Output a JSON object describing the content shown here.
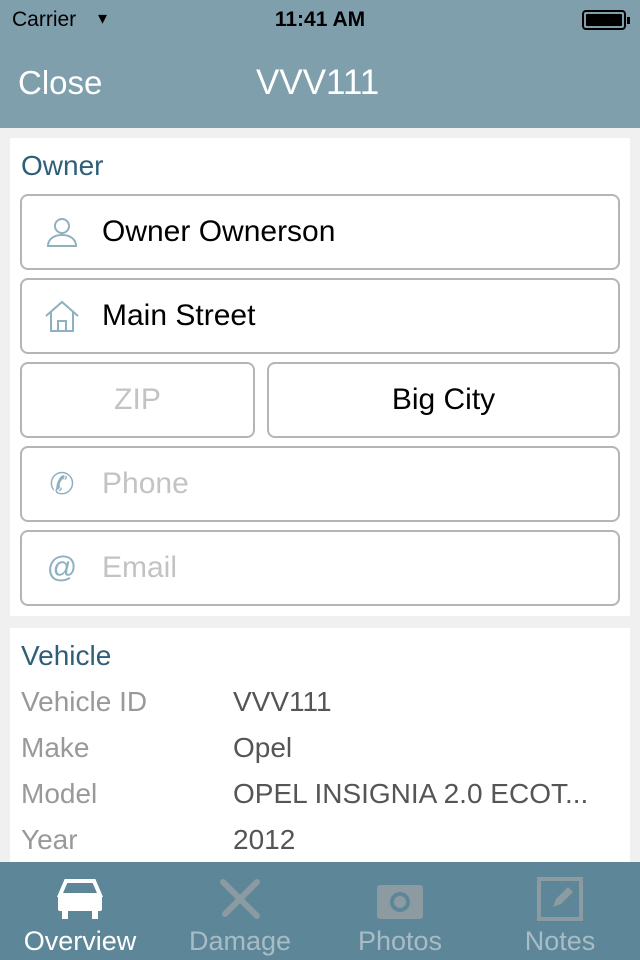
{
  "status_bar": {
    "carrier": "Carrier",
    "time": "11:41 AM"
  },
  "nav": {
    "close_label": "Close",
    "title": "VVV111"
  },
  "owner": {
    "section_title": "Owner",
    "name": "Owner Ownerson",
    "street": "Main Street",
    "zip_placeholder": "ZIP",
    "city": "Big City",
    "phone_placeholder": "Phone",
    "email_placeholder": "Email"
  },
  "vehicle": {
    "section_title": "Vehicle",
    "rows": [
      {
        "label": "Vehicle ID",
        "value": "VVV111"
      },
      {
        "label": "Make",
        "value": "Opel"
      },
      {
        "label": "Model",
        "value": "OPEL INSIGNIA 2.0 ECOT..."
      },
      {
        "label": "Year",
        "value": "2012"
      }
    ]
  },
  "tabs": [
    {
      "label": "Overview",
      "icon": "car-icon",
      "active": true
    },
    {
      "label": "Damage",
      "icon": "tools-icon",
      "active": false
    },
    {
      "label": "Photos",
      "icon": "camera-icon",
      "active": false
    },
    {
      "label": "Notes",
      "icon": "edit-note-icon",
      "active": false
    }
  ],
  "colors": {
    "header": "#7f9fad",
    "tabbar": "#5d8798",
    "section_title": "#2e5f78"
  }
}
